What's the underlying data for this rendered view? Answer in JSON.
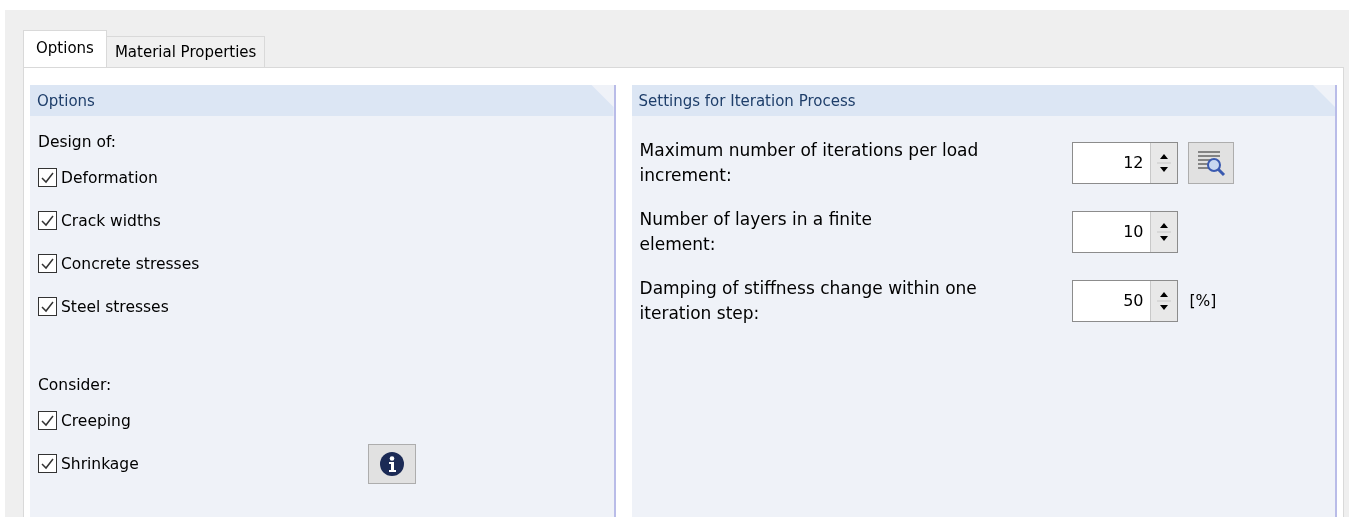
{
  "tabs": [
    {
      "label": "Options",
      "selected": true
    },
    {
      "label": "Material Properties",
      "selected": false
    }
  ],
  "options_panel": {
    "title": "Options",
    "groups": [
      {
        "heading": "Design of:",
        "items": [
          {
            "label": "Deformation",
            "checked": true
          },
          {
            "label": "Crack widths",
            "checked": true
          },
          {
            "label": "Concrete stresses",
            "checked": true
          },
          {
            "label": "Steel stresses",
            "checked": true
          }
        ]
      },
      {
        "heading": "Consider:",
        "items": [
          {
            "label": "Creeping",
            "checked": true
          },
          {
            "label": "Shrinkage",
            "checked": true,
            "info_button": true
          }
        ]
      }
    ]
  },
  "iteration_panel": {
    "title": "Settings for Iteration Process",
    "fields": [
      {
        "label": "Maximum number of iterations per load\nincrement:",
        "value": "12",
        "details_button": true
      },
      {
        "label": "Number of layers in a finite\nelement:",
        "value": "10"
      },
      {
        "label": "Damping of stiffness change within one\niteration step:",
        "value": "50",
        "unit": "[%]"
      }
    ]
  }
}
